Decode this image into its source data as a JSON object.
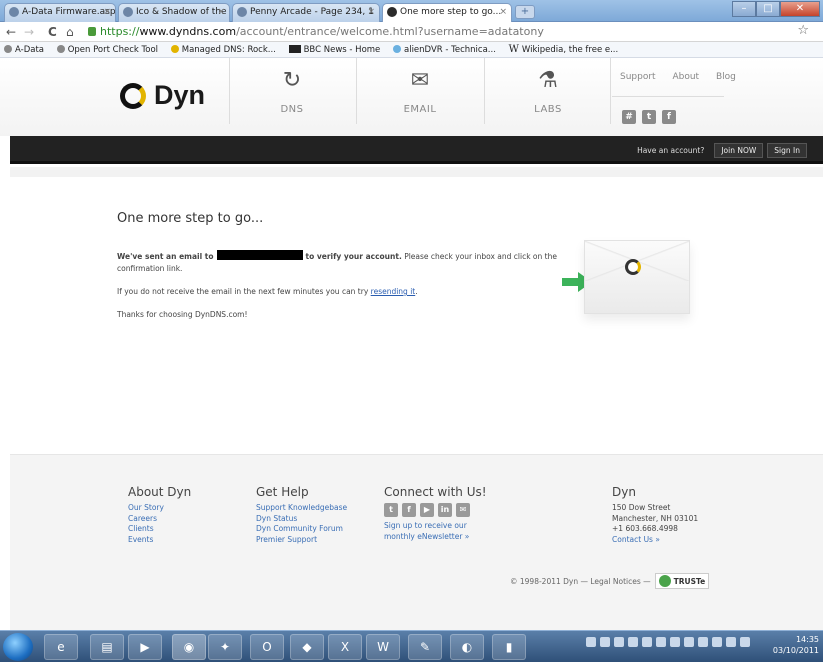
{
  "browser": {
    "tabs": [
      {
        "label": "A-Data Firmware.aspx - Ap",
        "active": false
      },
      {
        "label": "Ico & Shadow of the Colos",
        "active": false
      },
      {
        "label": "Penny Arcade - Page 234, 1",
        "active": false
      },
      {
        "label": "One more step to go...",
        "active": true
      }
    ],
    "window_buttons": {
      "minimize": "–",
      "maximize": "□",
      "close": "✕"
    },
    "nav": {
      "back": "←",
      "forward": "→",
      "reload": "C",
      "home": "⌂"
    },
    "url": {
      "scheme": "https://",
      "host": "www.dyndns.com",
      "path": "/account/entrance/welcome.html?username=adatatony"
    },
    "star": "☆",
    "bookmarks": [
      "A-Data",
      "Open Port Check Tool",
      "Managed DNS: Rock...",
      "BBC News - Home",
      "alienDVR - Technica...",
      "Wikipedia, the free e..."
    ]
  },
  "site": {
    "logo_text": "Dyn",
    "nav": [
      {
        "label": "DNS",
        "icon": "refresh-arrows-icon"
      },
      {
        "label": "EMAIL",
        "icon": "envelope-icon"
      },
      {
        "label": "LABS",
        "icon": "flask-icon"
      }
    ],
    "top_links": [
      "Support",
      "About",
      "Blog"
    ],
    "top_social": [
      "share-icon",
      "twitter-icon",
      "facebook-icon"
    ],
    "account_bar": {
      "question": "Have an account?",
      "join": "Join NOW",
      "signin": "Sign In"
    }
  },
  "main": {
    "title": "One more step to go...",
    "email_sent_prefix": "We've sent an email to",
    "email_sent_bold_suffix": "to verify your account.",
    "email_sent_rest": " Please check your inbox and click on the confirmation link.",
    "resend_prefix": "If you do not receive the email in the next few minutes you can try ",
    "resend_link": "resending it",
    "resend_suffix": ".",
    "thanks": "Thanks for choosing DynDNS.com!"
  },
  "footer": {
    "about": {
      "heading": "About Dyn",
      "links": [
        "Our Story",
        "Careers",
        "Clients",
        "Events"
      ]
    },
    "help": {
      "heading": "Get Help",
      "links": [
        "Support Knowledgebase",
        "Dyn Status",
        "Dyn Community Forum",
        "Premier Support"
      ]
    },
    "connect": {
      "heading": "Connect with Us!",
      "icons": [
        "twitter-icon",
        "facebook-icon",
        "youtube-icon",
        "linkedin-icon",
        "email-icon"
      ],
      "signup_line1": "Sign up to receive our",
      "signup_line2": "monthly eNewsletter »"
    },
    "contact": {
      "heading": "Dyn",
      "address1": "150 Dow Street",
      "address2": "Manchester, NH 03101",
      "phone": "+1 603.668.4998",
      "contact_link": "Contact Us »"
    },
    "copyright": "© 1998-2011 Dyn — Legal Notices —",
    "truste": "TRUSTe"
  },
  "taskbar": {
    "time": "14:35",
    "date": "03/10/2011"
  }
}
